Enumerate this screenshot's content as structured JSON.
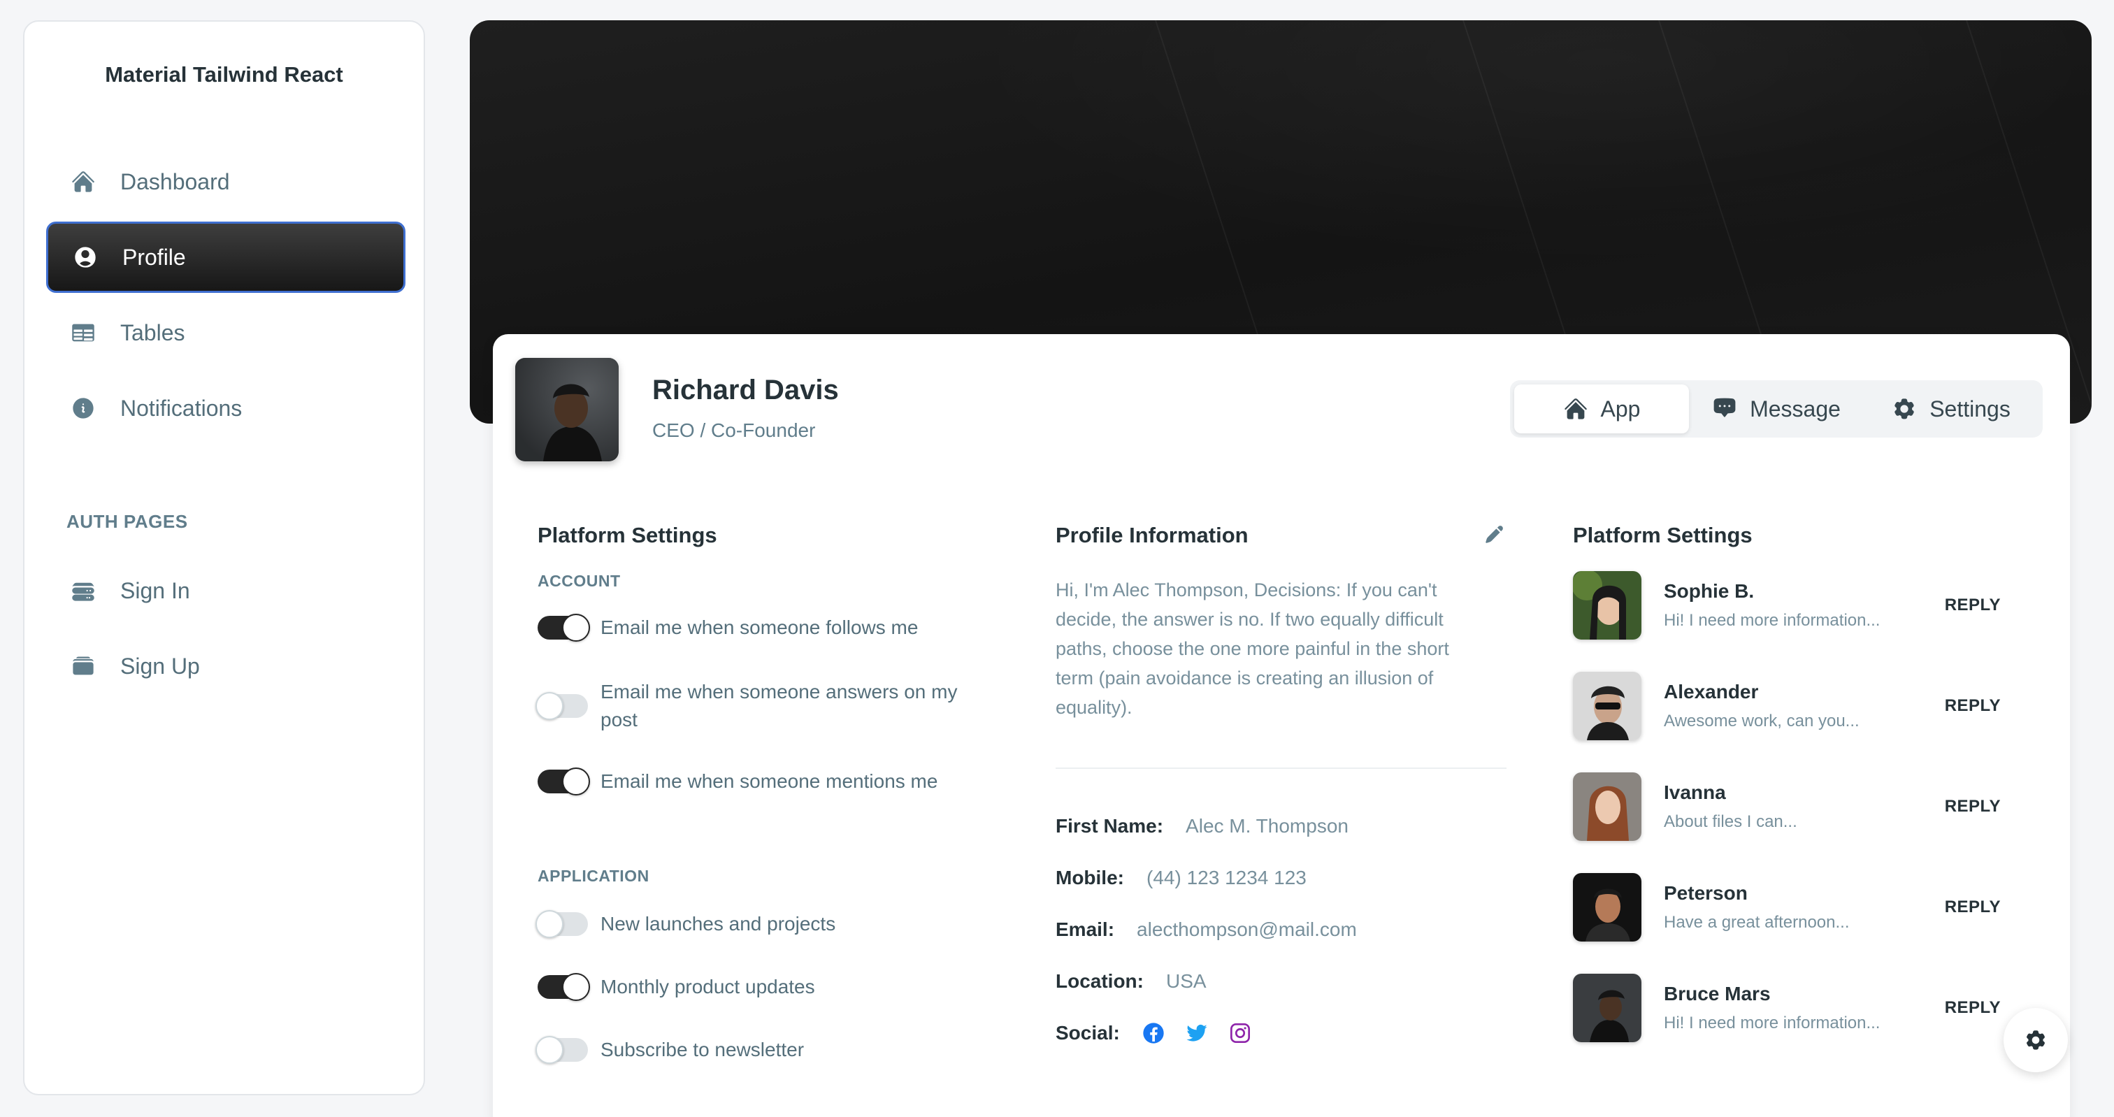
{
  "sidebar": {
    "brand": "Material Tailwind React",
    "items": [
      {
        "label": "Dashboard",
        "icon": "home-icon"
      },
      {
        "label": "Profile",
        "icon": "user-circle-icon"
      },
      {
        "label": "Tables",
        "icon": "table-icon"
      },
      {
        "label": "Notifications",
        "icon": "info-icon"
      }
    ],
    "auth_label": "AUTH PAGES",
    "auth_items": [
      {
        "label": "Sign In",
        "icon": "server-stack-icon"
      },
      {
        "label": "Sign Up",
        "icon": "rectangle-stack-icon"
      }
    ]
  },
  "profile": {
    "name": "Richard Davis",
    "role": "CEO / Co-Founder"
  },
  "tabs": [
    {
      "label": "App",
      "icon": "home-icon"
    },
    {
      "label": "Message",
      "icon": "chat-icon"
    },
    {
      "label": "Settings",
      "icon": "gear-icon"
    }
  ],
  "platform_settings": {
    "title": "Platform Settings",
    "account_label": "ACCOUNT",
    "account": [
      {
        "label": "Email me when someone follows me",
        "checked": true
      },
      {
        "label": "Email me when someone answers on my post",
        "checked": false
      },
      {
        "label": "Email me when someone mentions me",
        "checked": true
      }
    ],
    "application_label": "APPLICATION",
    "application": [
      {
        "label": "New launches and projects",
        "checked": false
      },
      {
        "label": "Monthly product updates",
        "checked": true
      },
      {
        "label": "Subscribe to newsletter",
        "checked": false
      }
    ]
  },
  "profile_info": {
    "title": "Profile Information",
    "bio": "Hi, I'm Alec Thompson, Decisions: If you can't decide, the answer is no. If two equally difficult paths, choose the one more painful in the short term (pain avoidance is creating an illusion of equality).",
    "fields": [
      {
        "key": "First Name:",
        "value": "Alec M. Thompson"
      },
      {
        "key": "Mobile:",
        "value": "(44) 123 1234 123"
      },
      {
        "key": "Email:",
        "value": "alecthompson@mail.com"
      },
      {
        "key": "Location:",
        "value": "USA"
      }
    ],
    "social_label": "Social:",
    "social": [
      {
        "icon": "facebook-icon",
        "color": "#1877f2"
      },
      {
        "icon": "twitter-icon",
        "color": "#1da1f2"
      },
      {
        "icon": "instagram-icon",
        "color": "#8e24aa"
      }
    ]
  },
  "conversations": {
    "title": "Platform Settings",
    "reply_label": "REPLY",
    "items": [
      {
        "name": "Sophie B.",
        "message": "Hi! I need more information..."
      },
      {
        "name": "Alexander",
        "message": "Awesome work, can you..."
      },
      {
        "name": "Ivanna",
        "message": "About files I can..."
      },
      {
        "name": "Peterson",
        "message": "Have a great afternoon..."
      },
      {
        "name": "Bruce Mars",
        "message": "Hi! I need more information..."
      }
    ]
  },
  "colors": {
    "active_nav_border": "#3f6fd0",
    "switch_on": "#262626",
    "switch_off": "#dfe3e6"
  }
}
